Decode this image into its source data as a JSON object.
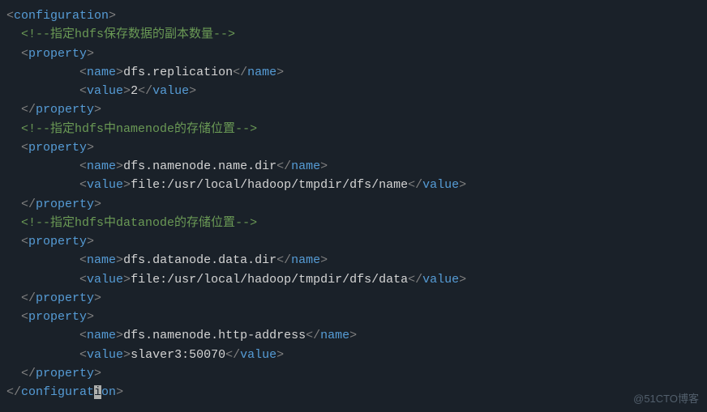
{
  "code": {
    "root_open": "configuration",
    "root_close_pre": "configurat",
    "root_close_cursor": "i",
    "root_close_post": "on",
    "comment1": "指定hdfs保存数据的副本数量",
    "comment2": "指定hdfs中namenode的存储位置",
    "comment3": "指定hdfs中datanode的存储位置",
    "property": "property",
    "name": "name",
    "value": "value",
    "p1_name": "dfs.replication",
    "p1_value": "2",
    "p2_name": "dfs.namenode.name.dir",
    "p2_value": "file:/usr/local/hadoop/tmpdir/dfs/name",
    "p3_name": "dfs.datanode.data.dir",
    "p3_value": "file:/usr/local/hadoop/tmpdir/dfs/data",
    "p4_name": "dfs.namenode.http-address",
    "p4_value": "slaver3:50070"
  },
  "watermark": "@51CTO博客"
}
